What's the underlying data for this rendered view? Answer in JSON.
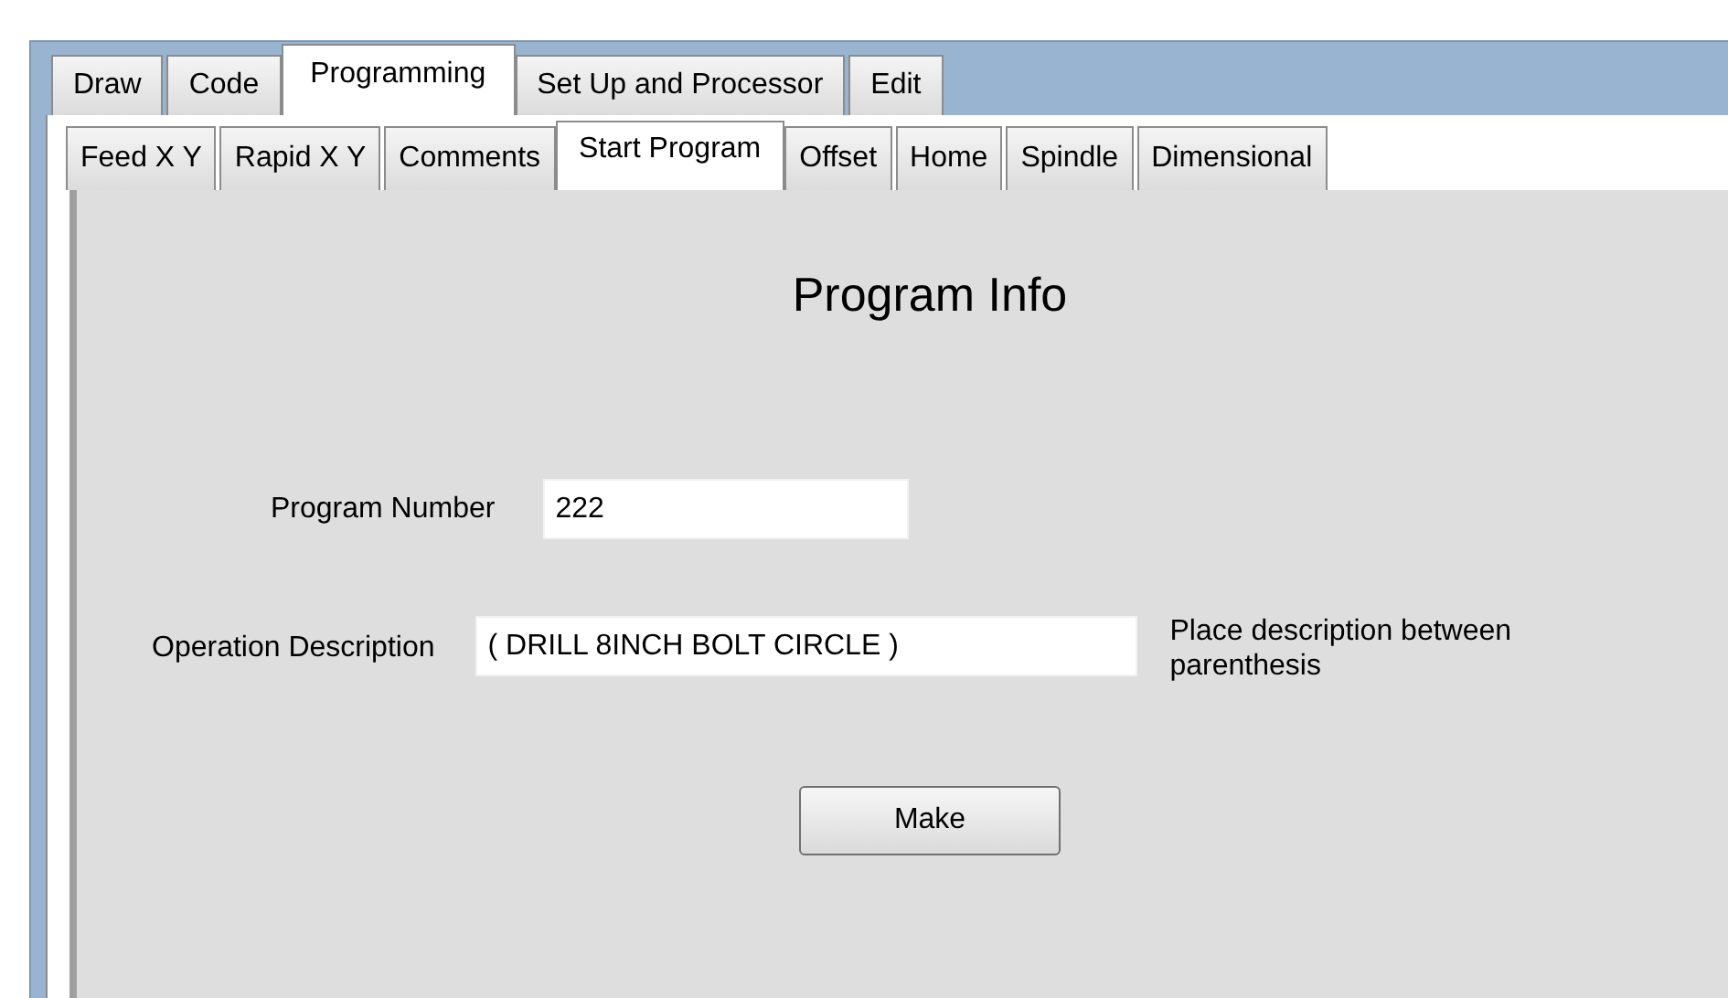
{
  "tabs": [
    {
      "label": "Draw",
      "selected": false
    },
    {
      "label": "Code",
      "selected": false
    },
    {
      "label": "Programming",
      "selected": true
    },
    {
      "label": "Set Up and Processor",
      "selected": false
    },
    {
      "label": "Edit",
      "selected": false
    }
  ],
  "subtabs": [
    {
      "label": "Feed X Y",
      "selected": false
    },
    {
      "label": "Rapid X Y",
      "selected": false
    },
    {
      "label": "Comments",
      "selected": false
    },
    {
      "label": "Start Program",
      "selected": true
    },
    {
      "label": "Offset",
      "selected": false
    },
    {
      "label": "Home",
      "selected": false
    },
    {
      "label": "Spindle",
      "selected": false
    },
    {
      "label": "Dimensional",
      "selected": false
    }
  ],
  "panel": {
    "title": "Program Info",
    "program_number": {
      "label": "Program Number",
      "value": "222"
    },
    "operation_description": {
      "label": "Operation Description",
      "value": "( DRILL 8INCH BOLT CIRCLE )",
      "hint": "Place description between parenthesis"
    },
    "button": "Make"
  }
}
